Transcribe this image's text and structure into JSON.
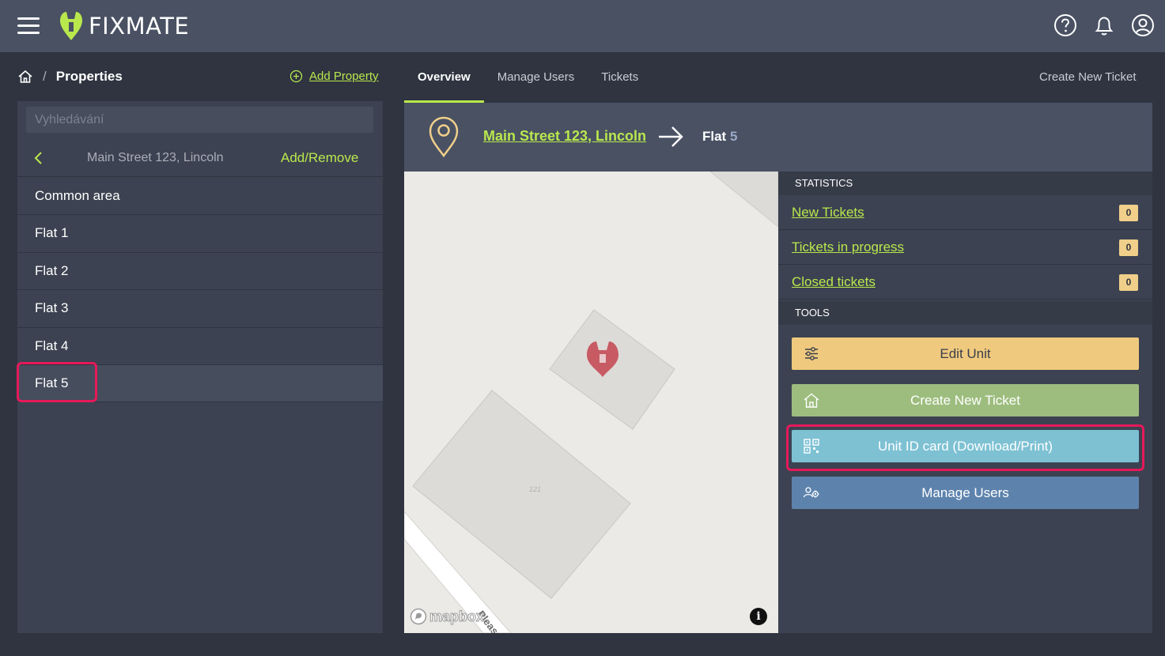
{
  "app": {
    "brand": "FIXMATE",
    "colors": {
      "accent": "#b9e84d",
      "topbar": "#495163",
      "highlight": "#e6195a",
      "badge": "#f0cf8a"
    },
    "icons": [
      "menu-icon",
      "help-icon",
      "bell-icon",
      "user-icon"
    ]
  },
  "breadcrumb": {
    "home_icon": "home-icon",
    "separator": "/",
    "current": "Properties"
  },
  "add_property": {
    "label": "Add Property",
    "icon": "plus-circle-icon"
  },
  "tabs": [
    {
      "label": "Overview",
      "active": true
    },
    {
      "label": "Manage Users",
      "active": false
    },
    {
      "label": "Tickets",
      "active": false
    }
  ],
  "create_ticket_link": "Create New Ticket",
  "sidebar": {
    "search_placeholder": "Vyhledávání",
    "property_name": "Main Street 123, Lincoln",
    "add_remove": "Add/Remove",
    "units": [
      {
        "label": "Common area"
      },
      {
        "label": "Flat 1"
      },
      {
        "label": "Flat 2"
      },
      {
        "label": "Flat 3"
      },
      {
        "label": "Flat 4"
      },
      {
        "label": "Flat 5",
        "selected": true
      }
    ]
  },
  "header": {
    "address": "Main Street 123, Lincoln",
    "unit_prefix": "Flat",
    "unit_number": "5"
  },
  "map": {
    "building_number": "121",
    "street_label": "Pleas",
    "attribution": "mapbox",
    "info": "i"
  },
  "statistics": {
    "title": "STATISTICS",
    "rows": [
      {
        "label": "New Tickets",
        "count": "0"
      },
      {
        "label": "Tickets in progress",
        "count": "0"
      },
      {
        "label": "Closed tickets",
        "count": "0"
      }
    ]
  },
  "tools": {
    "title": "TOOLS",
    "edit_unit": "Edit Unit",
    "create_ticket": "Create New Ticket",
    "unit_id_card": "Unit ID card (Download/Print)",
    "manage_users": "Manage Users"
  }
}
